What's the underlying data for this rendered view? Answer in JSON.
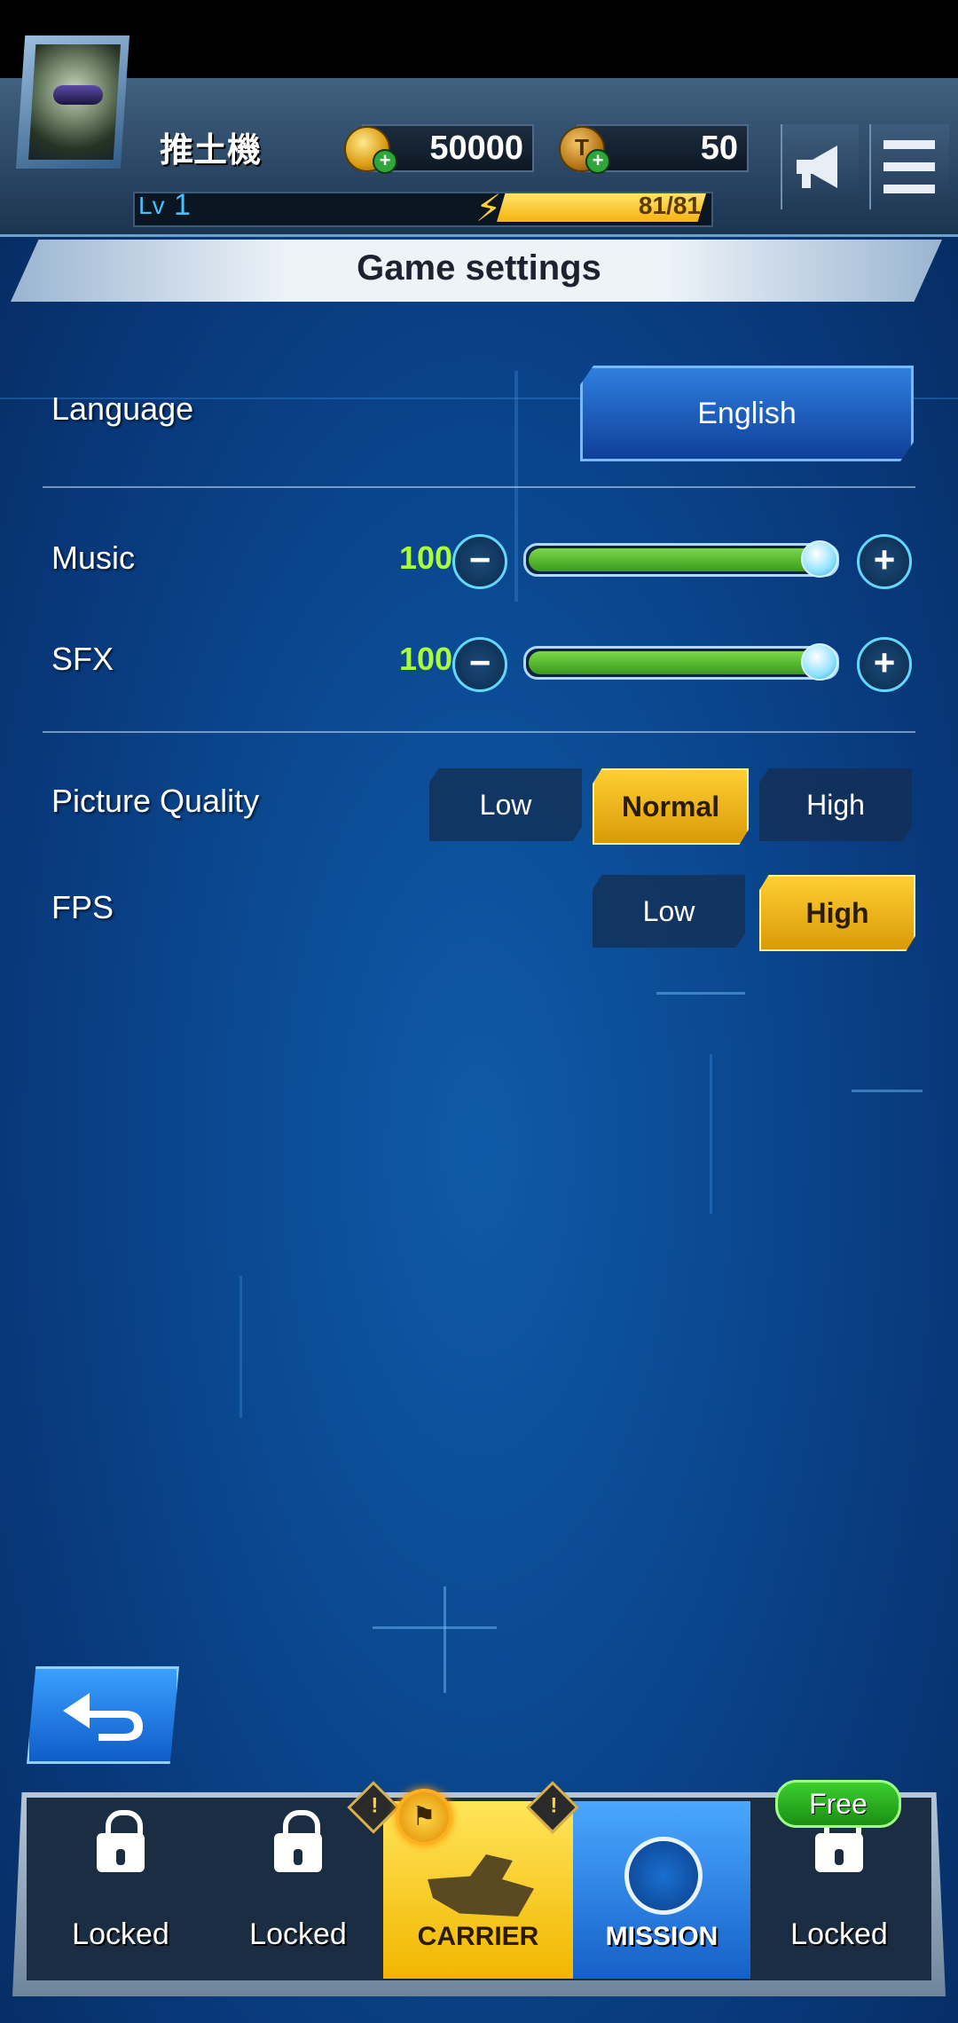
{
  "hud": {
    "player_name": "推土機",
    "level_label": "Lv",
    "level": "1",
    "gold": "50000",
    "tickets": "50",
    "energy": "81/81",
    "coin_letter": "T"
  },
  "title": "Game settings",
  "settings": {
    "language_label": "Language",
    "language_value": "English",
    "music_label": "Music",
    "music_value": "100",
    "music_level": 1.0,
    "sfx_label": "SFX",
    "sfx_value": "100",
    "sfx_level": 1.0,
    "quality_label": "Picture Quality",
    "quality_options": [
      "Low",
      "Normal",
      "High"
    ],
    "quality_selected": "Normal",
    "fps_label": "FPS",
    "fps_options": [
      "Low",
      "High"
    ],
    "fps_selected": "High"
  },
  "nav": {
    "items": [
      {
        "label": "Locked",
        "state": "locked"
      },
      {
        "label": "Locked",
        "state": "locked"
      },
      {
        "label": "CARRIER",
        "state": "active"
      },
      {
        "label": "MISSION",
        "state": "normal"
      },
      {
        "label": "Locked",
        "state": "locked"
      }
    ],
    "free_badge": "Free",
    "warning_glyph": "!"
  },
  "colors": {
    "accent_yellow": "#f2b600",
    "accent_blue": "#1560c8",
    "volume_green": "#7ad848",
    "volume_text": "#a8ff3a"
  },
  "icons": [
    "megaphone-icon",
    "menu-icon",
    "lock-icon",
    "back-arrow-icon",
    "radar-icon",
    "flag-icon",
    "lightning-icon",
    "gold-coin-icon",
    "ticket-coin-icon"
  ]
}
